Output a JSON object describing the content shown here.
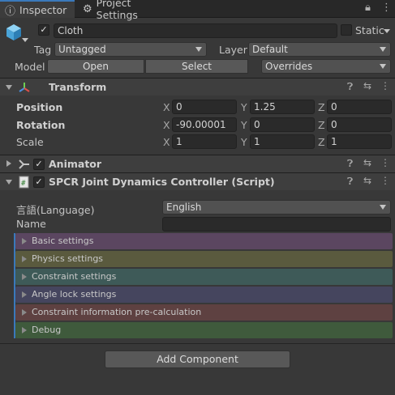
{
  "tabs": [
    {
      "label": "Inspector",
      "icon": "info-icon"
    },
    {
      "label": "Project Settings",
      "icon": "gear-icon"
    }
  ],
  "object": {
    "name": "Cloth",
    "static_label": "Static",
    "tag_label": "Tag",
    "tag_value": "Untagged",
    "layer_label": "Layer",
    "layer_value": "Default",
    "model_label": "Model",
    "open_label": "Open",
    "select_label": "Select",
    "overrides_label": "Overrides"
  },
  "transform": {
    "title": "Transform",
    "position_label": "Position",
    "rotation_label": "Rotation",
    "scale_label": "Scale",
    "position": {
      "x": "0",
      "y": "1.25",
      "z": "0"
    },
    "rotation": {
      "x": "-90.00001",
      "y": "0",
      "z": "0"
    },
    "scale": {
      "x": "1",
      "y": "1",
      "z": "1"
    }
  },
  "animator": {
    "title": "Animator"
  },
  "script": {
    "title": "SPCR Joint Dynamics Controller (Script)",
    "language_label": "言語(Language)",
    "language_value": "English",
    "name_label": "Name",
    "name_value": "",
    "sections": [
      {
        "label": "Basic settings",
        "color": "#5b4660"
      },
      {
        "label": "Physics settings",
        "color": "#5a5a3e"
      },
      {
        "label": "Constraint settings",
        "color": "#3e5a58"
      },
      {
        "label": "Angle lock settings",
        "color": "#45455e"
      },
      {
        "label": "Constraint information pre-calculation",
        "color": "#5e4141"
      },
      {
        "label": "Debug",
        "color": "#3f5a3c"
      }
    ]
  },
  "add_component_label": "Add Component"
}
